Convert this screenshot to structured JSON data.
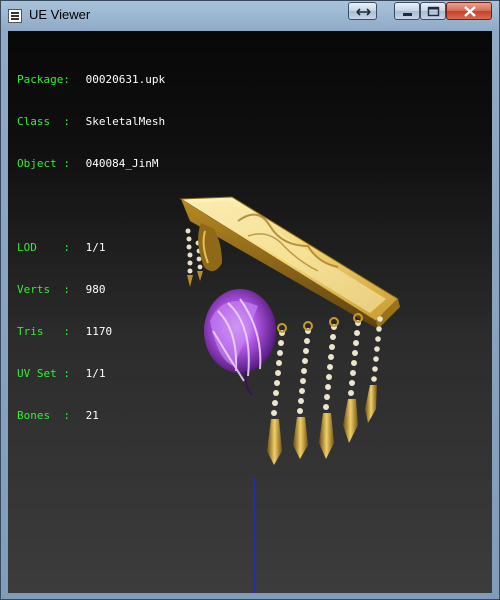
{
  "window": {
    "title": "UE Viewer"
  },
  "info": {
    "package": {
      "label": "Package:",
      "value": "00020631.upk"
    },
    "class": {
      "label": "Class  :",
      "value": "SkeletalMesh"
    },
    "object": {
      "label": "Object :",
      "value": "040084_JinM"
    },
    "lod": {
      "label": "LOD    :",
      "value": "1/1"
    },
    "verts": {
      "label": "Verts  :",
      "value": "980"
    },
    "tris": {
      "label": "Tris   :",
      "value": "1170"
    },
    "uvset": {
      "label": "UV Set :",
      "value": "1/1"
    },
    "bones": {
      "label": "Bones  :",
      "value": "21"
    }
  },
  "colors": {
    "label": "#33ee33",
    "value": "#ffffff",
    "axis_line": "#1a2bd8",
    "gold": "#d9b23c",
    "hair": "#a845e0"
  },
  "icons": [
    "app-icon",
    "swap-icon",
    "minimize-icon",
    "maximize-icon",
    "close-icon"
  ]
}
